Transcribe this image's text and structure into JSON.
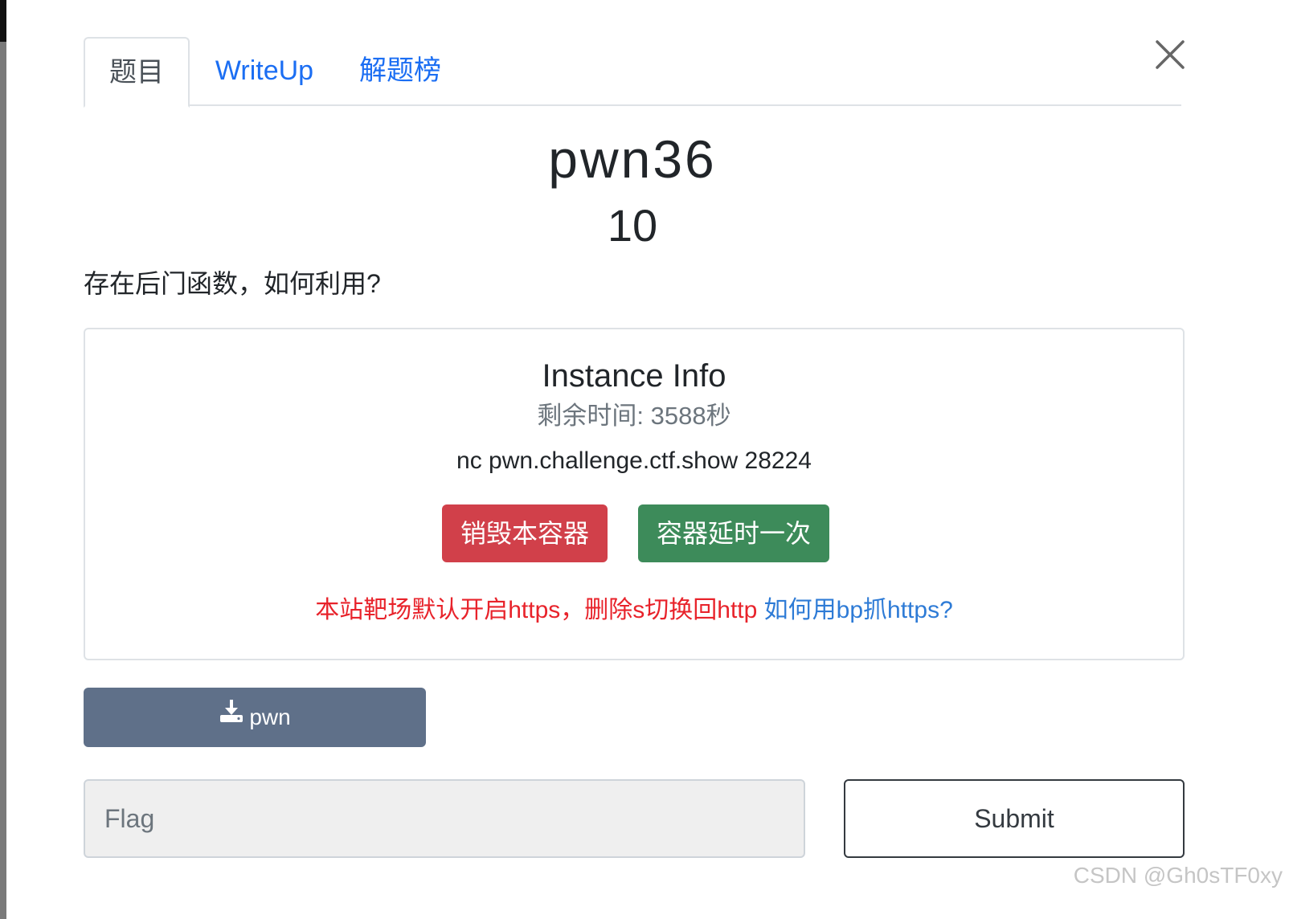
{
  "tabs": [
    {
      "label": "题目",
      "active": true
    },
    {
      "label": "WriteUp",
      "active": false
    },
    {
      "label": "解题榜",
      "active": false
    }
  ],
  "close_icon": "close-icon",
  "challenge": {
    "name": "pwn36",
    "score": "10",
    "description": "存在后门函数，如何利用?"
  },
  "instance": {
    "title": "Instance Info",
    "remaining": "剩余时间: 3588秒",
    "command": "nc pwn.challenge.ctf.show 28224",
    "destroy_label": "销毁本容器",
    "extend_label": "容器延时一次",
    "notice_warn": "本站靶场默认开启https，删除s切换回http",
    "notice_link": "如何用bp抓https?"
  },
  "download": {
    "icon": "download-icon",
    "label": "pwn"
  },
  "flag": {
    "placeholder": "Flag",
    "value": "",
    "submit_label": "Submit"
  },
  "watermark": "CSDN @Gh0sTF0xy",
  "colors": {
    "tab_link": "#1b6ef3",
    "danger": "#d1404a",
    "success": "#3d8b5a",
    "secondary": "#5f7089",
    "warn_text": "#e8232b",
    "link_text": "#2e7bd6"
  }
}
